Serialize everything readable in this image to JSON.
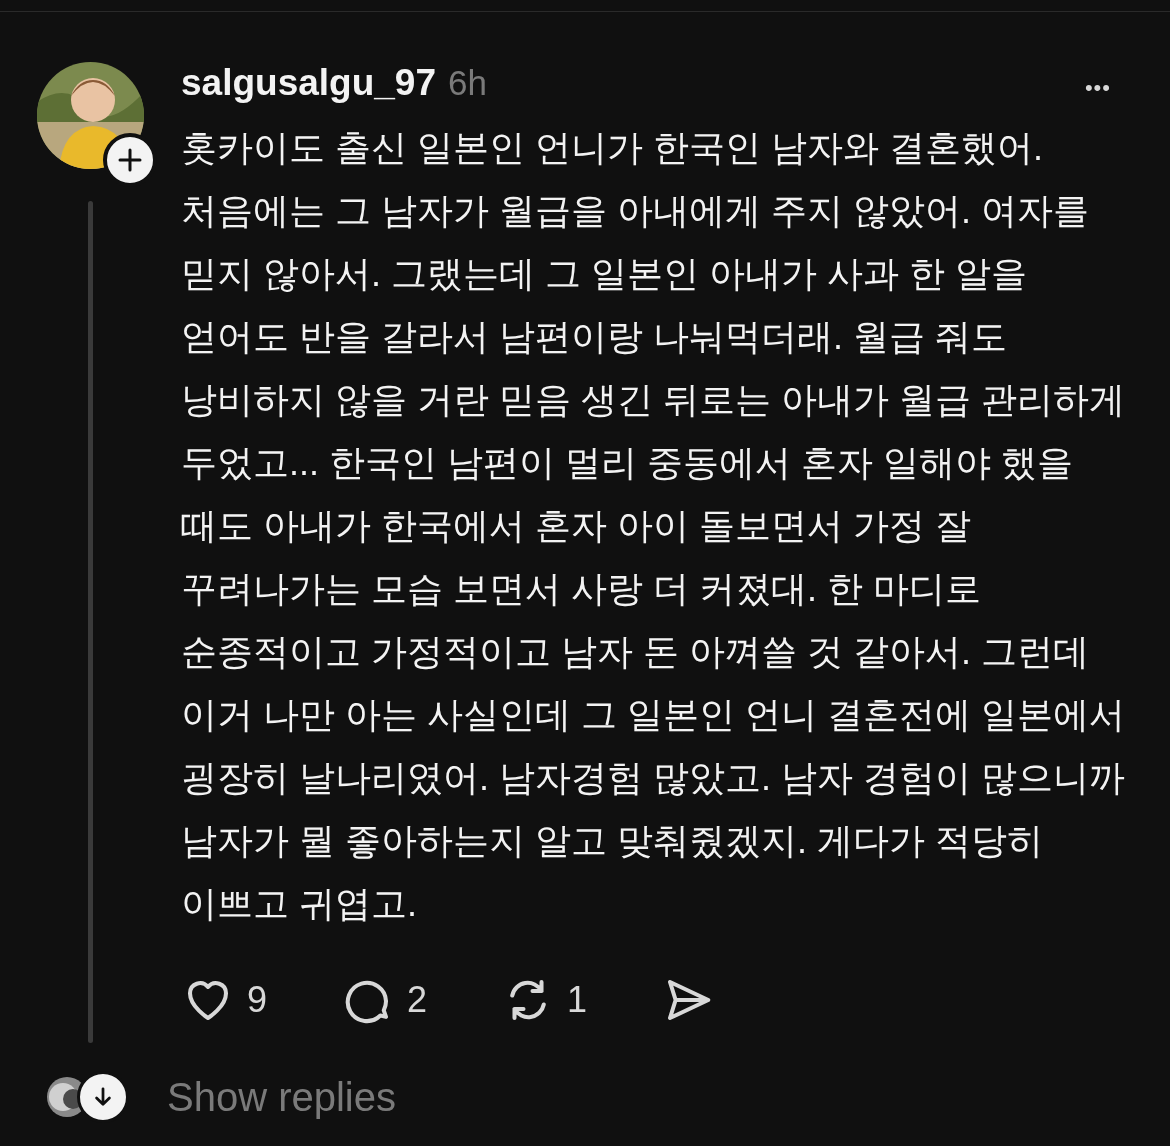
{
  "post": {
    "username": "salgusalgu_97",
    "time": "6h",
    "more": "•••",
    "body": "홋카이도 출신 일본인 언니가 한국인 남자와 결혼했어. 처음에는 그 남자가 월급을 아내에게 주지 않았어. 여자를 믿지 않아서. 그랬는데 그 일본인 아내가 사과 한 알을 얻어도 반을 갈라서 남편이랑 나눠먹더래. 월급 줘도 낭비하지 않을 거란 믿음 생긴 뒤로는 아내가 월급 관리하게 두었고... 한국인 남편이 멀리 중동에서 혼자 일해야 했을 때도 아내가 한국에서 혼자 아이 돌보면서 가정 잘 꾸려나가는 모습 보면서 사랑 더 커졌대. 한 마디로 순종적이고 가정적이고 남자 돈 아껴쓸 것 같아서. 그런데 이거 나만 아는 사실인데 그 일본인 언니 결혼전에 일본에서 굉장히 날나리였어. 남자경험 많았고. 남자 경험이 많으니까 남자가 뭘 좋아하는지 알고 맞춰줬겠지. 게다가 적당히 이쁘고 귀엽고.",
    "actions": [
      {
        "kind": "like",
        "count": "9"
      },
      {
        "kind": "reply",
        "count": "2"
      },
      {
        "kind": "repost",
        "count": "1"
      },
      {
        "kind": "share"
      }
    ]
  },
  "replies": {
    "label": "Show replies"
  }
}
